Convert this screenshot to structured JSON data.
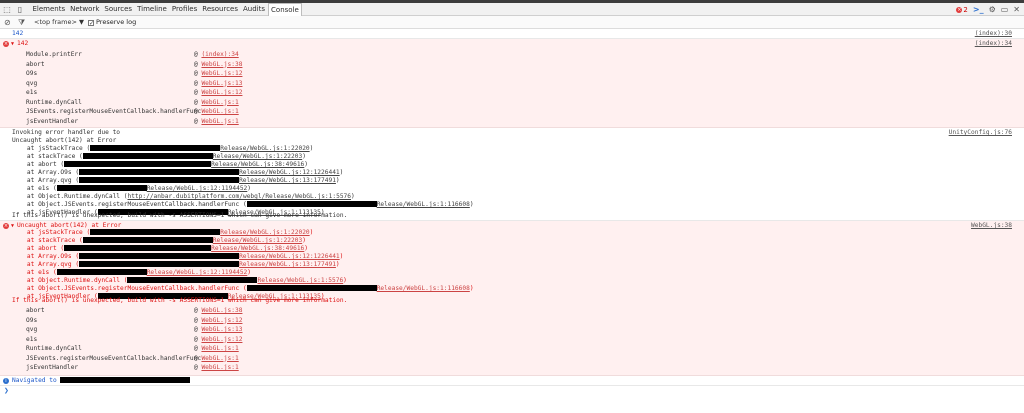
{
  "tabs": {
    "items": [
      "Elements",
      "Network",
      "Sources",
      "Timeline",
      "Profiles",
      "Resources",
      "Audits",
      "Console"
    ],
    "active": "Console"
  },
  "toolbar": {
    "error_count": "2",
    "frame_select": "<top frame>",
    "frame_arrow": "▼",
    "preserve_log_label": "Preserve log",
    "preserve_log_checked": true
  },
  "messages": {
    "m1": {
      "text": "142",
      "source": "(index):30"
    },
    "m2": {
      "text": "142",
      "source": "(index):34",
      "stack": [
        {
          "fn": "Module.printErr",
          "loc": "(index):34"
        },
        {
          "fn": "abort",
          "loc": "WebGL.js:38"
        },
        {
          "fn": "O9s",
          "loc": "WebGL.js:12"
        },
        {
          "fn": "qvg",
          "loc": "WebGL.js:13"
        },
        {
          "fn": "e1s",
          "loc": "WebGL.js:12"
        },
        {
          "fn": "Runtime.dynCall",
          "loc": "WebGL.js:1"
        },
        {
          "fn": "JSEvents.registerMouseEventCallback.handlerFunc",
          "loc": "WebGL.js:1"
        },
        {
          "fn": "jsEventHandler",
          "loc": "WebGL.js:1"
        }
      ]
    },
    "m3": {
      "source": "UnityConfig.js:76",
      "line1": "Invoking error handler due to",
      "line2": "Uncaught abort(142) at Error",
      "frames": [
        {
          "prefix": "    at jsStackTrace (",
          "loc": "Release/WebGL.js:1:22020",
          "suffix": ")"
        },
        {
          "prefix": "    at stackTrace (",
          "loc": "Release/WebGL.js:1:22203",
          "suffix": ")"
        },
        {
          "prefix": "    at abort (",
          "loc": "Release/WebGL.js:38:49616",
          "suffix": ")"
        },
        {
          "prefix": "    at Array.O9s (",
          "loc": "Release/WebGL.js:12:1226441",
          "suffix": ")"
        },
        {
          "prefix": "    at Array.qvg (",
          "loc": "Release/WebGL.js:13:177491",
          "suffix": ")"
        },
        {
          "prefix": "    at e1s (",
          "loc": "Release/WebGL.js:12:1194452",
          "suffix": ")"
        },
        {
          "prefix": "    at Object.Runtime.dynCall (",
          "loc": "http://anbar.dubitplatform.com/webgl/Release/WebGL.js:1:5576",
          "suffix": ")"
        },
        {
          "prefix": "    at Object.JSEvents.registerMouseEventCallback.handlerFunc (",
          "loc": "Release/WebGL.js:1:116608",
          "suffix": ")"
        },
        {
          "prefix": "    at jsEventHandler (",
          "loc": "Release/WebGL.js:1:113135",
          "suffix": ")"
        }
      ],
      "footer": "If this abort() is unexpected, build with -s ASSERTIONS=1 which can give more information."
    },
    "m4": {
      "source": "WebGL.js:38",
      "line1": "Uncaught abort(142) at Error",
      "frames": [
        {
          "prefix": "    at jsStackTrace (",
          "loc": "Release/WebGL.js:1:22020",
          "suffix": ")"
        },
        {
          "prefix": "    at stackTrace (",
          "loc": "Release/WebGL.js:1:22203",
          "suffix": ")"
        },
        {
          "prefix": "    at abort (",
          "loc": "Release/WebGL.js:38:49616",
          "suffix": ")"
        },
        {
          "prefix": "    at Array.O9s (",
          "loc": "Release/WebGL.js:12:1226441",
          "suffix": ")"
        },
        {
          "prefix": "    at Array.qvg (",
          "loc": "Release/WebGL.js:13:177491",
          "suffix": ")"
        },
        {
          "prefix": "    at e1s (",
          "loc": "Release/WebGL.js:12:1194452",
          "suffix": ")"
        },
        {
          "prefix": "    at Object.Runtime.dynCall (",
          "loc": "Release/WebGL.js:1:5576",
          "suffix": ")"
        },
        {
          "prefix": "    at Object.JSEvents.registerMouseEventCallback.handlerFunc (",
          "loc": "Release/WebGL.js:1:116608",
          "suffix": ")"
        },
        {
          "prefix": "    at jsEventHandler (",
          "loc": "Release/WebGL.js:1:113135",
          "suffix": ")"
        }
      ],
      "footer": "If this abort() is unexpected, build with -s ASSERTIONS=1 which can give more information.",
      "stack": [
        {
          "fn": "abort",
          "loc": "WebGL.js:38"
        },
        {
          "fn": "O9s",
          "loc": "WebGL.js:12"
        },
        {
          "fn": "qvg",
          "loc": "WebGL.js:13"
        },
        {
          "fn": "e1s",
          "loc": "WebGL.js:12"
        },
        {
          "fn": "Runtime.dynCall",
          "loc": "WebGL.js:1"
        },
        {
          "fn": "JSEvents.registerMouseEventCallback.handlerFunc",
          "loc": "WebGL.js:1"
        },
        {
          "fn": "jsEventHandler",
          "loc": "WebGL.js:1"
        }
      ]
    },
    "m5": {
      "text": "Navigated to"
    }
  },
  "prompt": "❯"
}
